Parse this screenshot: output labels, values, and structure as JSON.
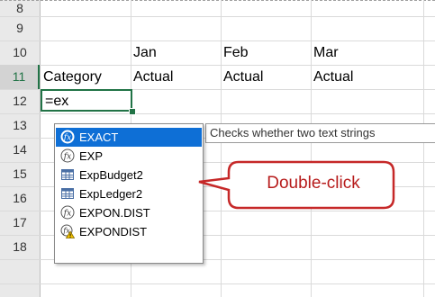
{
  "rows": [
    "8",
    "9",
    "10",
    "11",
    "12",
    "13",
    "14",
    "15",
    "16",
    "17",
    "18"
  ],
  "active_row": "11",
  "cells": {
    "jan": "Jan",
    "feb": "Feb",
    "mar": "Mar",
    "category": "Category",
    "actual_jan": "Actual",
    "actual_feb": "Actual",
    "actual_mar": "Actual"
  },
  "formula_entry": "=ex",
  "autocomplete": {
    "items": [
      {
        "label": "EXACT",
        "icon": "function-icon",
        "selected": true
      },
      {
        "label": "EXP",
        "icon": "function-icon",
        "selected": false
      },
      {
        "label": "ExpBudget2",
        "icon": "table-icon",
        "selected": false
      },
      {
        "label": "ExpLedger2",
        "icon": "table-icon",
        "selected": false
      },
      {
        "label": "EXPON.DIST",
        "icon": "function-icon",
        "selected": false
      },
      {
        "label": "EXPONDIST",
        "icon": "function-warning-icon",
        "selected": false
      }
    ],
    "tooltip": "Checks whether two text strings"
  },
  "callout": {
    "text": "Double-click",
    "color": "#c62828"
  },
  "colors": {
    "selection": "#0e6fd6",
    "active_border": "#217346"
  }
}
